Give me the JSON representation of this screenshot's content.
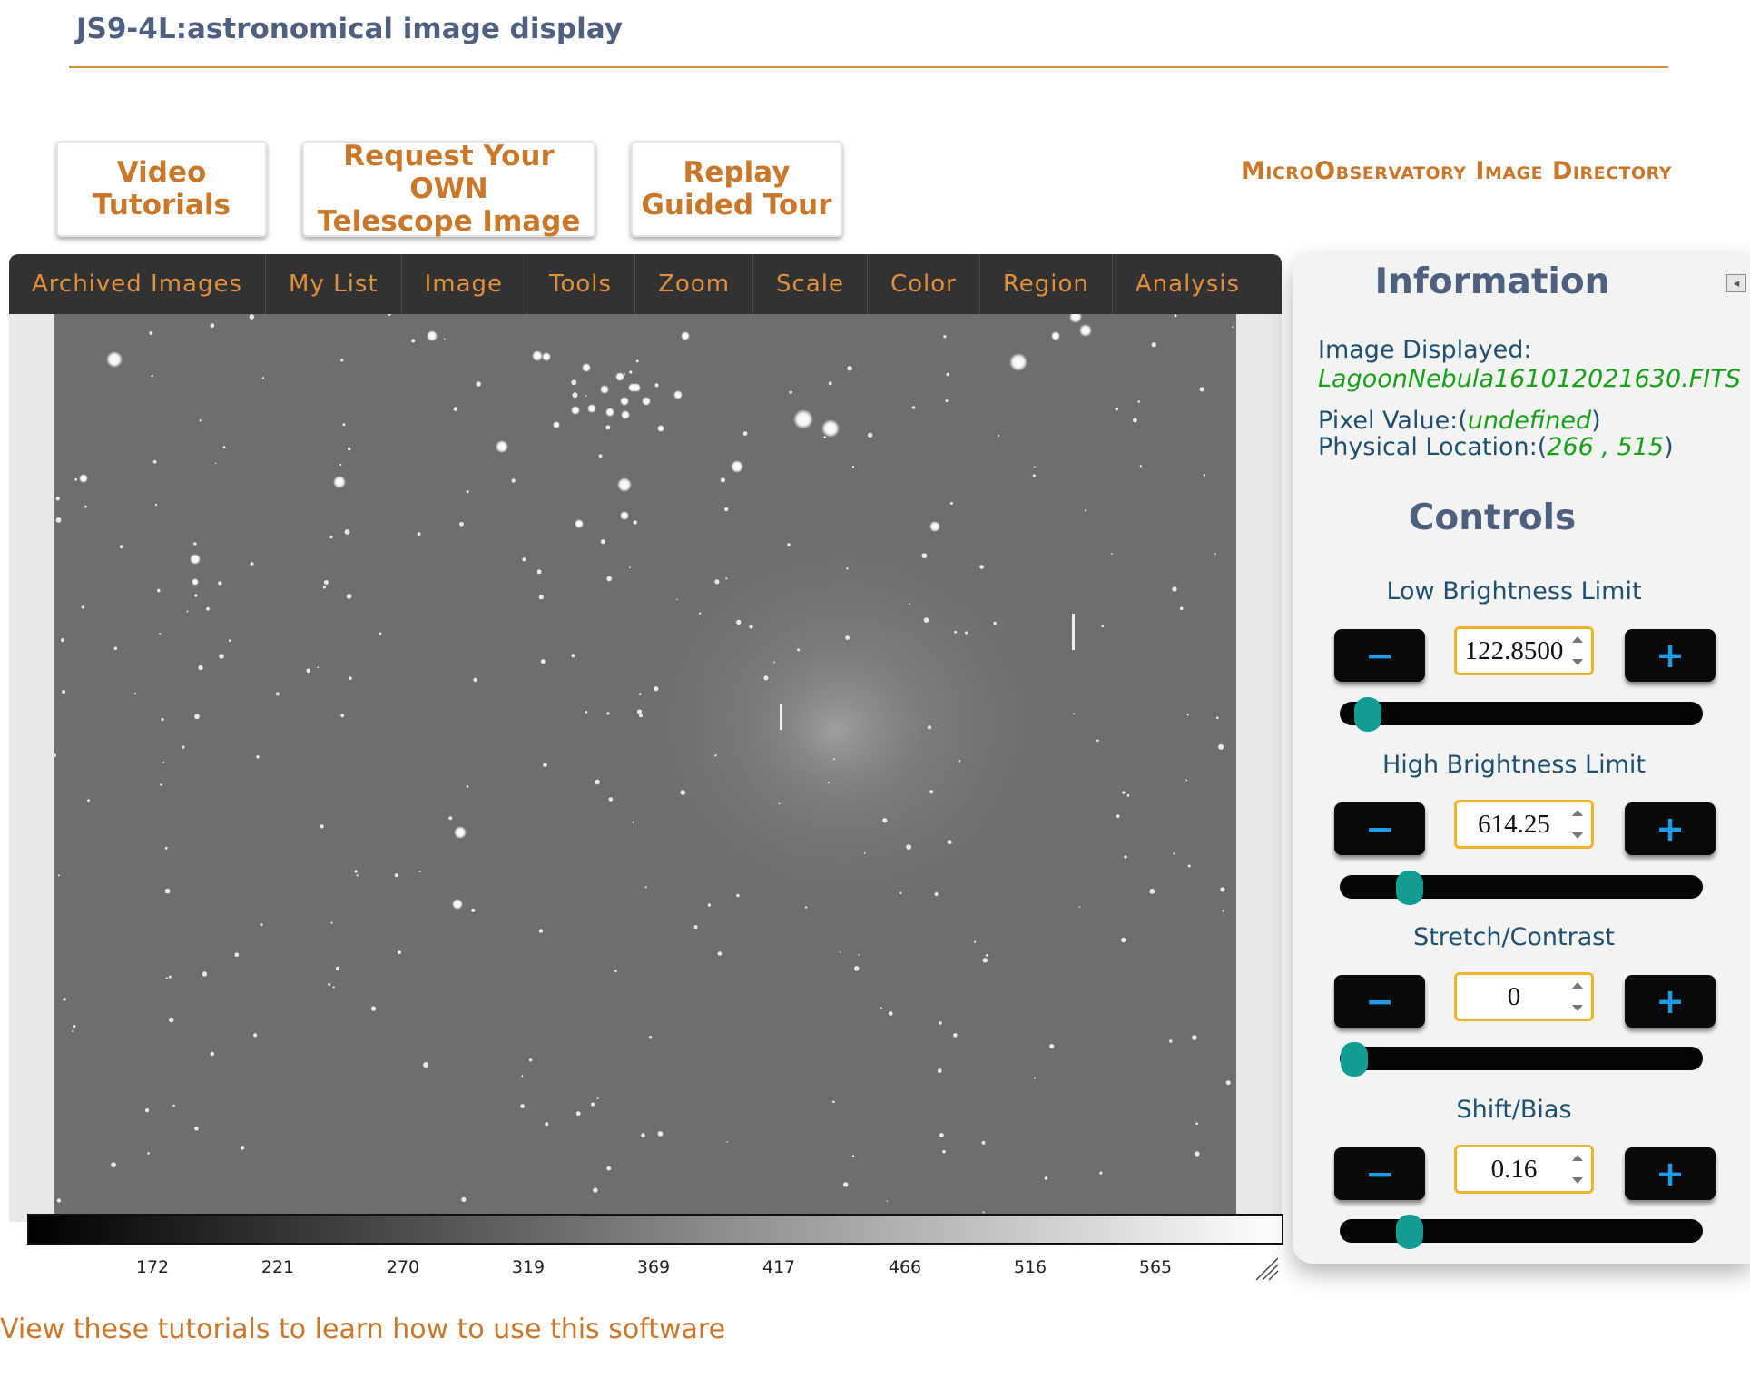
{
  "app": {
    "title": "JS9-4L:astronomical image display"
  },
  "top_buttons": {
    "video": "Video\nTutorials",
    "request": "Request Your OWN\nTelescope Image",
    "replay": "Replay\nGuided Tour"
  },
  "directory_link": "MicroObservatory Image Directory",
  "menu": [
    "Archived Images",
    "My List",
    "Image",
    "Tools",
    "Zoom",
    "Scale",
    "Color",
    "Region",
    "Analysis"
  ],
  "colorbar": {
    "ticks": [
      "172",
      "221",
      "270",
      "319",
      "369",
      "417",
      "466",
      "516",
      "565"
    ]
  },
  "footer": {
    "tutorial_link": "View these tutorials to learn how to use this software"
  },
  "panel": {
    "info_title": "Information",
    "image_displayed_label": "Image Displayed:",
    "image_displayed_value": "LagoonNebula161012021630.FITS",
    "pixel_value_label": "Pixel Value:",
    "pixel_value": "undefined",
    "physical_location_label": "Physical Location:",
    "physical_location_value": "266 , 515",
    "controls_title": "Controls",
    "controls": [
      {
        "label": "Low Brightness Limit",
        "value": "122.8500",
        "slider_fraction": 0.06,
        "minus": "−",
        "plus": "+"
      },
      {
        "label": "High Brightness Limit",
        "value": "614.25",
        "slider_fraction": 0.18,
        "minus": "−",
        "plus": "+"
      },
      {
        "label": "Stretch/Contrast",
        "value": "0",
        "slider_fraction": 0.02,
        "minus": "−",
        "plus": "+"
      },
      {
        "label": "Shift/Bias",
        "value": "0.16",
        "slider_fraction": 0.18,
        "minus": "−",
        "plus": "+"
      }
    ]
  },
  "icons": {
    "collapse": "collapse-left-icon",
    "resize": "resize-grip-icon"
  }
}
